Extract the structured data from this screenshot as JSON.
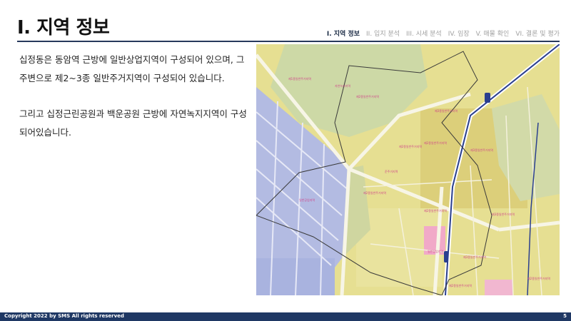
{
  "page": {
    "title": "I. 지역 정보",
    "nav": [
      {
        "label": "I. 지역 정보",
        "active": true
      },
      {
        "label": "II. 입지 분석",
        "active": false
      },
      {
        "label": "III. 시세 분석",
        "active": false
      },
      {
        "label": "IV. 임장",
        "active": false
      },
      {
        "label": "V. 매물 확인",
        "active": false
      },
      {
        "label": "VI. 결론 및 평가",
        "active": false
      }
    ],
    "paragraphs": [
      "십정동은 동암역 근방에 일반상업지역이 구성되어 있으며, 그 주변으로 제2~3종 일반주거지역이 구성되어 있습니다.",
      "그리고 십정근린공원과 백운공원 근방에 자연녹지지역이 구성되어있습니다."
    ],
    "map": {
      "labels": [
        "제1종일반주거지역",
        "제2종일반주거지역",
        "제3종일반주거지역",
        "자연녹지지역",
        "일반상업지역",
        "준주거지역",
        "일반공업지역"
      ],
      "colors": {
        "residential_2": "#ece79a",
        "residential_3": "#e3d884",
        "green": "#cdd9a6",
        "commercial": "#f1a9c8",
        "industrial": "#b3bbe2",
        "road": "#f7f5e6",
        "boundary": "#3a3a3a",
        "rail": "#2a3f8f"
      }
    },
    "footer": {
      "copyright": "Copyright 2022 by SMS All rights reserved",
      "page_number": "5"
    }
  }
}
